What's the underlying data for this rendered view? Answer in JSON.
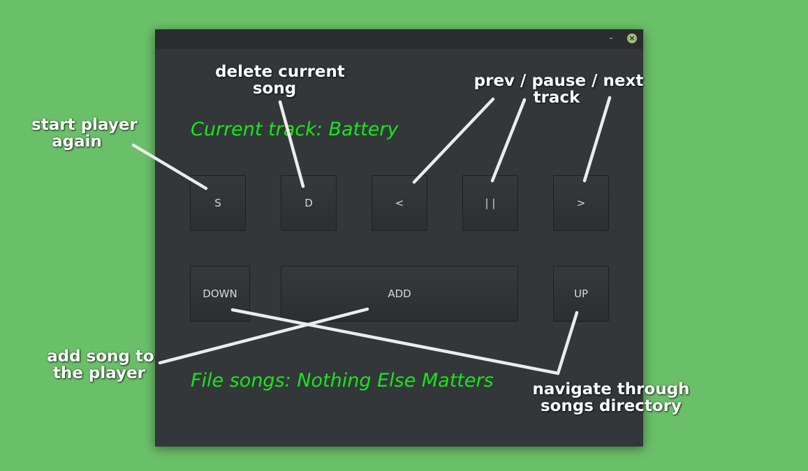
{
  "window": {
    "minimize_label": "-",
    "close_label": "×"
  },
  "player": {
    "current_track_text": "Current track: Battery",
    "file_songs_text": "File songs: Nothing Else Matters",
    "buttons": {
      "start": "S",
      "delete": "D",
      "prev": "<",
      "pause": "| |",
      "next": ">",
      "down": "DOWN",
      "add": "ADD",
      "up": "UP"
    }
  },
  "annotations": {
    "start_line1": "start player",
    "start_line2": "again",
    "delete_line1": "delete current",
    "delete_line2": "song",
    "controls_line1": "prev / pause / next",
    "controls_line2": "track",
    "add_line1": "add song to",
    "add_line2": "the player",
    "navigate_line1": "navigate through",
    "navigate_line2": "songs directory"
  },
  "colors": {
    "background": "#6abf69",
    "window": "#33373a",
    "titlebar": "#2a2c2e",
    "accent_text": "#19e619",
    "close_button": "#9fbf7c"
  }
}
